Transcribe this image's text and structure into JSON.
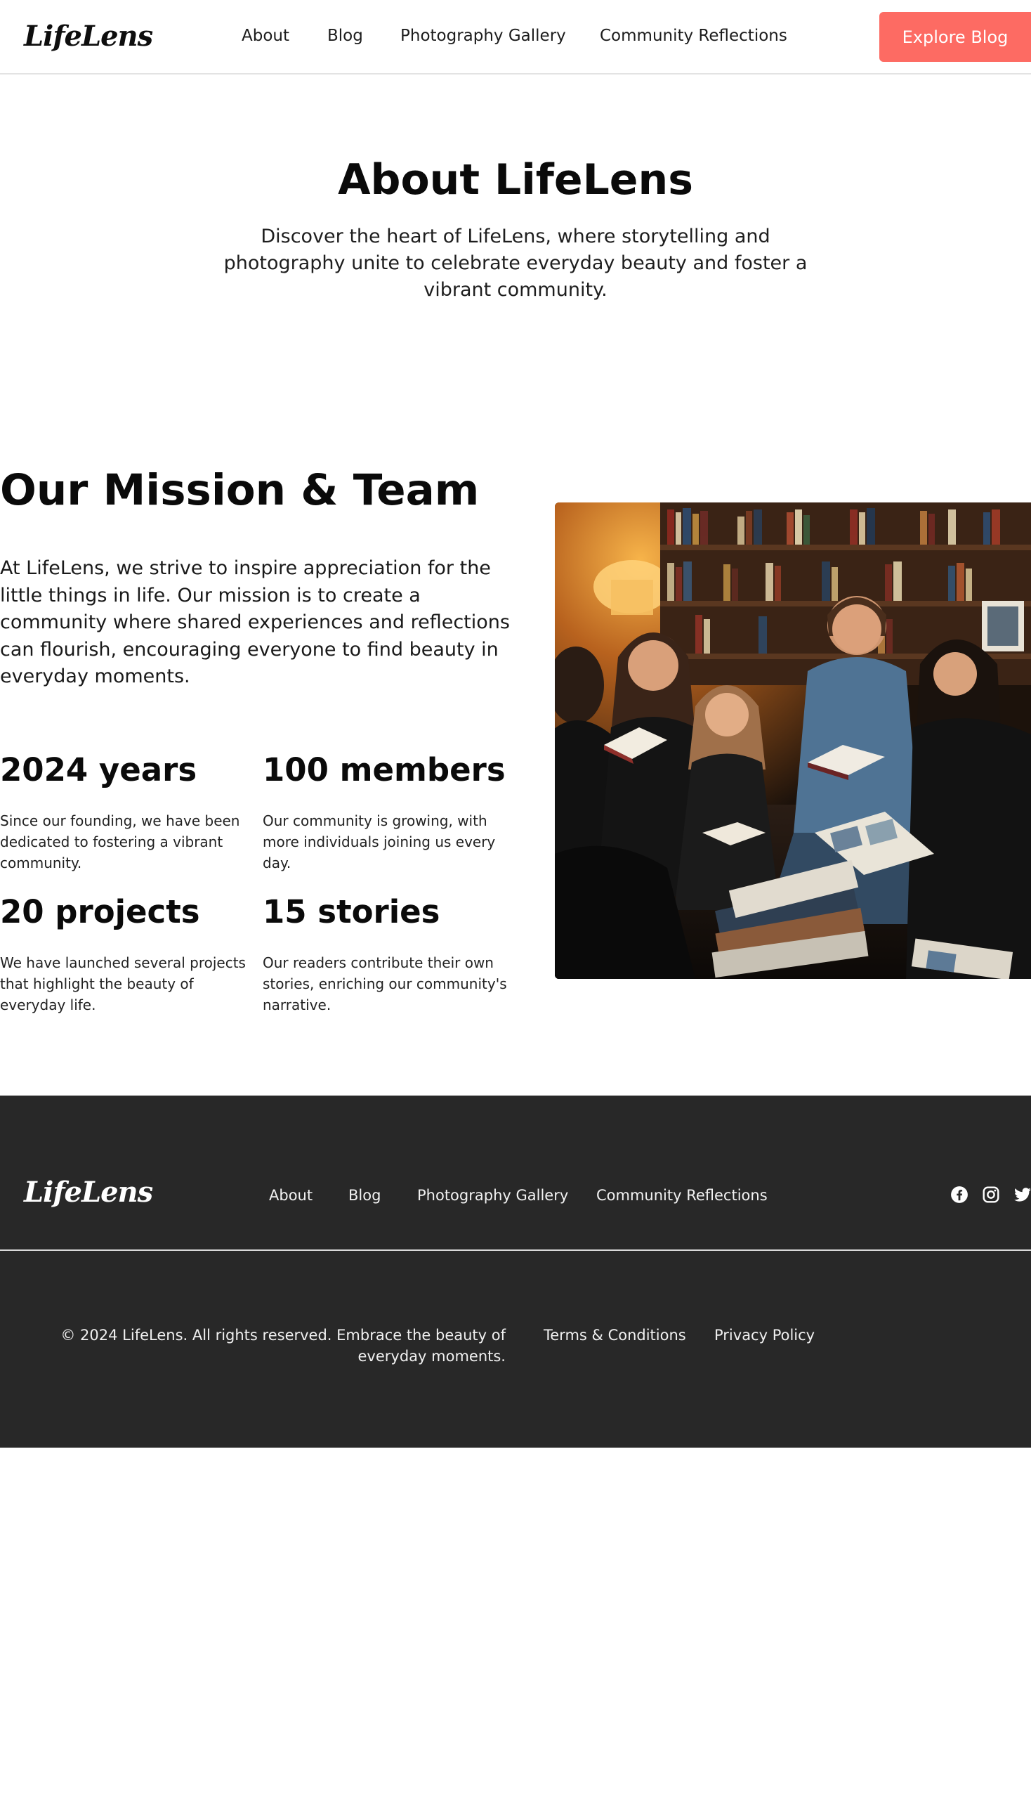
{
  "header": {
    "logo": "LifeLens",
    "nav": [
      "About",
      "Blog",
      "Photography Gallery",
      "Community Reflections"
    ],
    "cta": "Explore Blog"
  },
  "hero": {
    "title": "About LifeLens",
    "subtitle": "Discover the heart of LifeLens, where storytelling and photography unite to celebrate everyday beauty and foster a vibrant community."
  },
  "mission": {
    "title": "Our Mission & Team",
    "text": "At LifeLens, we strive to inspire appreciation for the little things in life. Our mission is to create a community where shared experiences and reflections can flourish, encouraging everyone to find beauty in everyday moments.",
    "stats": [
      {
        "value": "2024 years",
        "desc": "Since our founding, we have been dedicated to fostering a vibrant community."
      },
      {
        "value": "100 members",
        "desc": "Our community is growing, with more individuals joining us every day."
      },
      {
        "value": "20 projects",
        "desc": "We have launched several projects that highlight the beauty of everyday life."
      },
      {
        "value": "15 stories",
        "desc": "Our readers contribute their own stories, enriching our community's narrative."
      }
    ],
    "image_description": "Group of friends sharing books in a cozy library"
  },
  "footer": {
    "logo": "LifeLens",
    "nav": [
      "About",
      "Blog",
      "Photography Gallery",
      "Community Reflections"
    ],
    "social": [
      "facebook-icon",
      "instagram-icon",
      "twitter-icon"
    ],
    "copyright": "© 2024 LifeLens. All rights reserved. Embrace the beauty of everyday moments.",
    "links": [
      "Terms & Conditions",
      "Privacy Policy"
    ]
  },
  "colors": {
    "accent": "#fd6b63",
    "footer_bg": "#282828",
    "text": "#111111"
  }
}
